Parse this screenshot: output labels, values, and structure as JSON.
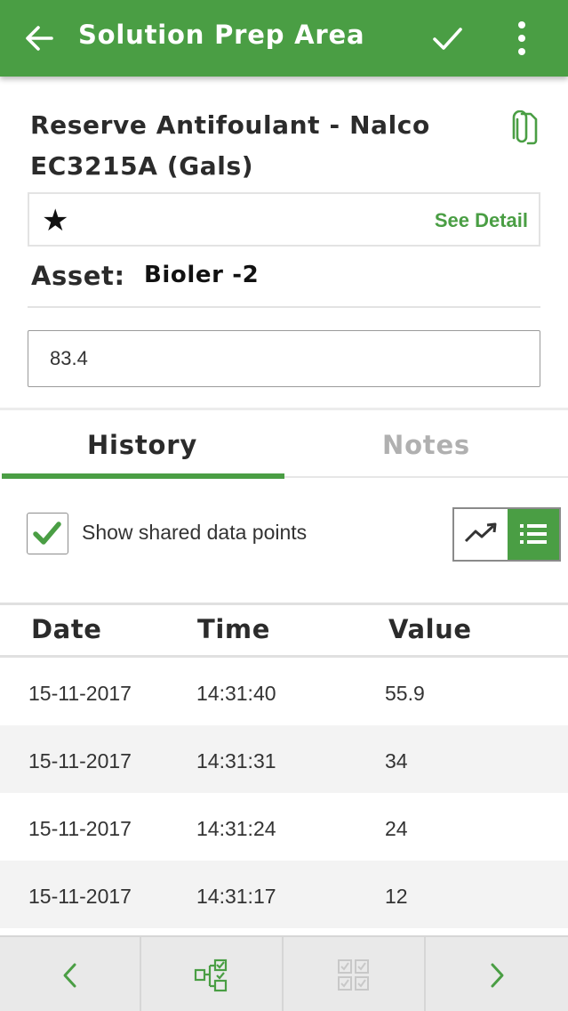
{
  "app_bar": {
    "title": "Solution Prep Area",
    "back_icon": "arrow-left-icon",
    "confirm_icon": "check-icon",
    "menu_icon": "more-vertical-icon"
  },
  "item": {
    "title": "Reserve Antifoulant - Nalco EC3215A (Gals)",
    "attachment_icon": "paperclip-icon",
    "star_icon": "★",
    "see_detail_label": "See Detail",
    "asset_label": "Asset:",
    "asset_value": "Bioler -2",
    "input_value": "83.4"
  },
  "tabs": [
    {
      "label": "History",
      "active": true
    },
    {
      "label": "Notes",
      "active": false
    }
  ],
  "history": {
    "show_shared_label": "Show shared data points",
    "show_shared_checked": true,
    "view_options": [
      "trend-chart-icon",
      "list-icon"
    ],
    "active_view": "list",
    "columns": [
      "Date",
      "Time",
      "Value"
    ],
    "rows": [
      {
        "date": "15-11-2017",
        "time": "14:31:40",
        "value": "55.9"
      },
      {
        "date": "15-11-2017",
        "time": "14:31:31",
        "value": "34"
      },
      {
        "date": "15-11-2017",
        "time": "14:31:24",
        "value": "24"
      },
      {
        "date": "15-11-2017",
        "time": "14:31:17",
        "value": "12"
      }
    ]
  },
  "bottom_bar": {
    "buttons": [
      "chevron-left-icon",
      "workflow-check-icon",
      "checklist-grid-icon",
      "chevron-right-icon"
    ]
  },
  "colors": {
    "primary": "#4a9e44",
    "muted": "#b0b0b0"
  }
}
